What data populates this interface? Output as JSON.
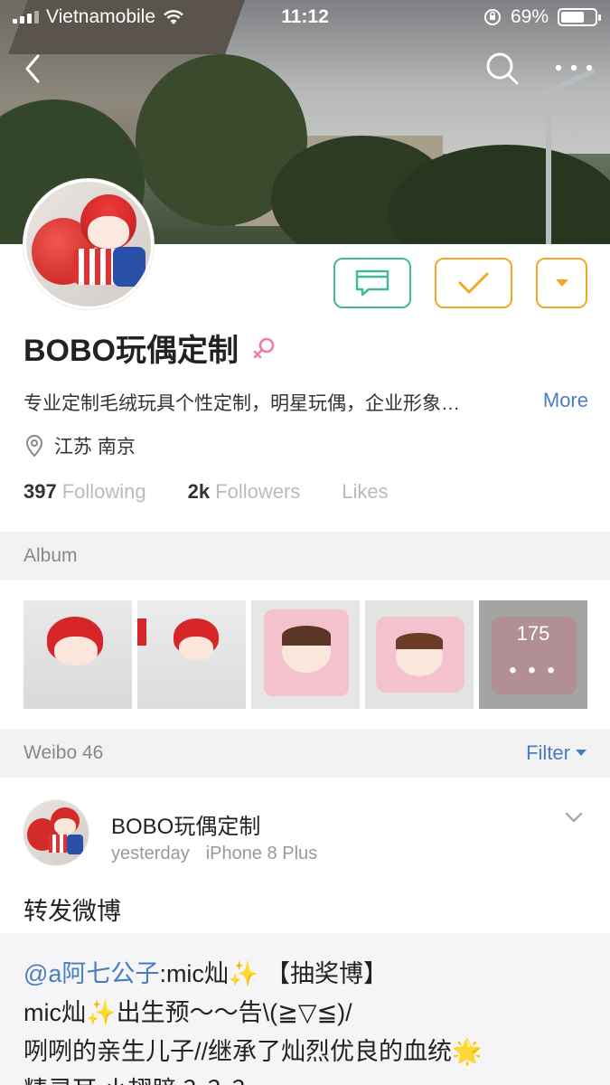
{
  "status_bar": {
    "carrier": "Vietnamobile",
    "time": "11:12",
    "battery": "69%",
    "battery_level": 0.69
  },
  "profile": {
    "name": "BOBO玩偶定制",
    "bio": "专业定制毛绒玩具个性定制，明星玩偶，企业形象…",
    "bio_more": "More",
    "location": "江苏 南京",
    "following_count": "397",
    "following_label": "Following",
    "followers_count": "2k",
    "followers_label": "Followers",
    "likes_label": "Likes"
  },
  "album": {
    "title": "Album",
    "more_count": "175",
    "more_dots": "• • •"
  },
  "weibo_section": {
    "title": "Weibo 46",
    "filter_label": "Filter"
  },
  "post": {
    "author": "BOBO玩偶定制",
    "time": "yesterday",
    "device": "iPhone 8 Plus",
    "text": "转发微博",
    "repost_mention": "@a阿七公子",
    "repost_line1": ":mic灿✨ 【抽奖博】",
    "repost_line2": "mic灿✨出生预～～告\\(≧▽≦)/",
    "repost_line3": "咧咧的亲生儿子//继承了灿烈优良的血统🌟",
    "repost_line4": "精灵耳 小翅膀 ？？？"
  },
  "colors": {
    "accent_blue": "#4a7dbf",
    "message_green": "#3fb99a",
    "follow_orange": "#f5a623",
    "female_pink": "#f07b9c"
  },
  "icons": [
    "back-icon",
    "search-icon",
    "more-icon",
    "message-icon",
    "check-icon",
    "dropdown-icon",
    "female-icon",
    "location-icon",
    "chevron-down-icon",
    "wifi-icon",
    "lock-rotation-icon"
  ]
}
